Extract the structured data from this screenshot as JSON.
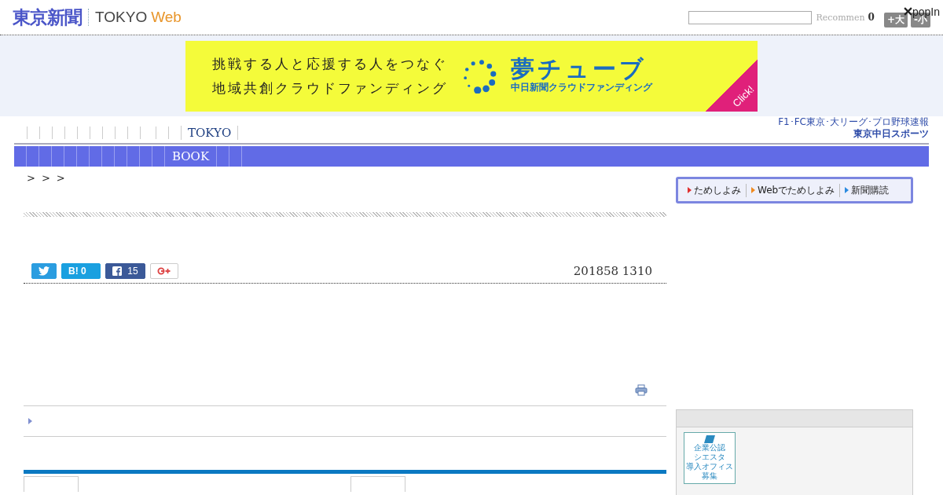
{
  "header": {
    "logo": "東京新聞",
    "site_name_1": "TOKYO",
    "site_name_2": "Web",
    "recommend": "Recommen",
    "count": "0",
    "font_buttons": [
      "+大",
      "-小"
    ],
    "popin": "popIn"
  },
  "banner": {
    "line_1": "挑戦する人と応援する人をつなぐ",
    "line_2": "地域共創クラウドファンディング",
    "brand": "夢チューブ",
    "brand_sub": "中日新聞クラウドファンディング",
    "corner": "Click!"
  },
  "top_nav": {
    "items": [
      "TOKYO"
    ],
    "sports_ad": {
      "line_1": "F1･FC東京･大リーグ･プロ野球速報",
      "line_2": "東京中日スポーツ"
    }
  },
  "main_nav": {
    "items": [
      "BOOK"
    ]
  },
  "breadcrumb": [
    ">",
    ">",
    ">"
  ],
  "subscribe": [
    {
      "label": "ためしよみ",
      "color": "#e03030"
    },
    {
      "label": "Webでためしよみ",
      "color": "#f08a20"
    },
    {
      "label": "新聞購読",
      "color": "#2a8ae0"
    }
  ],
  "share": {
    "hatena": "B!",
    "hatena_count": "0",
    "facebook_count": "15"
  },
  "date": "201858 1310",
  "side_badge": {
    "line_1": "企業公認",
    "line_2": "シエスタ",
    "line_3": "導入オフィス",
    "line_4": "募集"
  }
}
